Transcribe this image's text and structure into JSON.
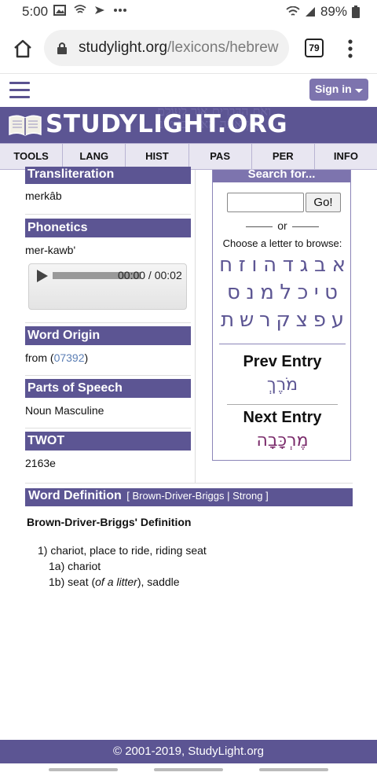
{
  "status_bar": {
    "time": "5:00",
    "battery": "89%",
    "icons": [
      "image-icon",
      "wifi-call-icon",
      "gesture-icon",
      "more-dots-icon",
      "wifi-icon",
      "signal-icon",
      "battery-icon"
    ]
  },
  "browser": {
    "url_domain": "studylight.org",
    "url_path": "/lexicons/hebrew",
    "tab_count": "79"
  },
  "site": {
    "signin_label": "Sign in",
    "logo_text": "StudyLight.org",
    "nav": [
      "TOOLS",
      "LANG",
      "HIST",
      "PAS",
      "PER",
      "INFO"
    ]
  },
  "word": {
    "transliteration_label": "Transliteration",
    "transliteration_value": "merkâb",
    "phonetics_label": "Phonetics",
    "phonetics_value": "mer-kawb'",
    "audio_time": "00:00 / 00:02",
    "origin_label": "Word Origin",
    "origin_prefix": "from (",
    "origin_link": "07392",
    "origin_suffix": ")",
    "pos_label": "Parts of Speech",
    "pos_value": "Noun Masculine",
    "twot_label": "TWOT",
    "twot_value": "2163e"
  },
  "sidebar": {
    "search_title": "Search for...",
    "go_label": "Go!",
    "or_label": "or",
    "choose_label": "Choose a letter to browse:",
    "letters_row1": [
      "א",
      "ב",
      "ג",
      "ד",
      "ה",
      "ו",
      "ז",
      "ח"
    ],
    "letters_row2": [
      "ט",
      "י",
      "כ",
      "ל",
      "מ",
      "נ",
      "ס"
    ],
    "letters_row3": [
      "ע",
      "פ",
      "צ",
      "ק",
      "ר",
      "ש",
      "ת"
    ],
    "prev_label": "Prev Entry",
    "prev_word": "מֹרֶךְ",
    "next_label": "Next Entry",
    "next_word": "מֶרְכָּבָה"
  },
  "definition": {
    "heading": "Word Definition",
    "links_open": "[",
    "link_bdb": "Brown-Driver-Briggs",
    "links_sep": "|",
    "link_strong": "Strong",
    "links_close": "]",
    "bdb_title": "Brown-Driver-Briggs' Definition",
    "item1": "1) chariot, place to ride, riding seat",
    "item1a": "1a) chariot",
    "item1b_pre": "1b) seat (",
    "item1b_em": "of a litter",
    "item1b_post": "), saddle"
  },
  "footer": {
    "copyright": "© 2001-2019, StudyLight.org"
  },
  "colors": {
    "brand_purple": "#5c5593",
    "light_purple": "#7d74ae",
    "link_blue": "#5c7fb5",
    "next_entry_color": "#7a2a6a"
  }
}
